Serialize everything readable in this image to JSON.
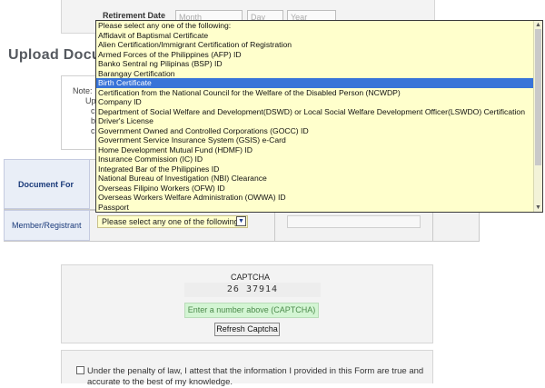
{
  "retirement": {
    "label": "Retirement Date",
    "month_placeholder": "Month",
    "day_placeholder": "Day",
    "year_placeholder": "Year"
  },
  "upload": {
    "heading": "Upload Docu",
    "notes_fragments": [
      "Note:",
      "Up",
      "c",
      "b",
      "c"
    ]
  },
  "table": {
    "document_for_label": "Document For",
    "member_label": "Member/Registrant",
    "select_value": "Please select any one of the following:"
  },
  "dropdown": {
    "options": [
      "Please select any one of the following:",
      "Affidavit of Baptismal Certificate",
      "Alien Certification/Immigrant Certification of Registration",
      "Armed Forces of the Philippines (AFP) ID",
      "Banko Sentral ng Pilipinas (BSP) ID",
      "Barangay Certification",
      "Birth Certificate",
      "Certification from the National Council for the Welfare of the Disabled Person (NCWDP)",
      "Company ID",
      "Department of Social Welfare and Development(DSWD) or Local Social Welfare Development Officer(LSWDO) Certification",
      "Driver's License",
      "Government Owned and Controlled Corporations (GOCC) ID",
      "Government Service Insurance System (GSIS) e-Card",
      "Home Development Mutual Fund (HDMF) ID",
      "Insurance Commission (IC) ID",
      "Integrated Bar of the Philippines ID",
      "National Bureau of Investigation (NBI) Clearance",
      "Overseas Filipino Workers (OFW) ID",
      "Overseas Workers Welfare Administration (OWWA) ID",
      "Passport"
    ],
    "selected_index": 6
  },
  "captcha": {
    "title": "CAPTCHA",
    "code": "26 37914",
    "input_placeholder": "Enter a number above (CAPTCHA)",
    "refresh_label": "Refresh Captcha"
  },
  "attestation": {
    "text": "Under the penalty of law, I attest that the information I provided in this Form are true and accurate to the best of my knowledge."
  }
}
